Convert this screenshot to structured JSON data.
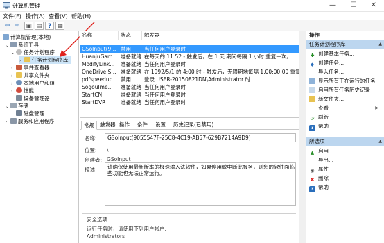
{
  "window": {
    "title": "计算机管理",
    "min_glyph": "—",
    "max_glyph": "☐",
    "close_glyph": "✕"
  },
  "menu": [
    "文件(F)",
    "操作(A)",
    "查看(V)",
    "帮助(H)"
  ],
  "toolbar": {
    "back_glyph": "⇦",
    "forward_glyph": "⇨",
    "up_glyph": "▣",
    "props_glyph": "▤",
    "help_glyph": "?",
    "view_glyph": "▦"
  },
  "tree": {
    "root": "计算机管理(本地)",
    "system_tools": "系统工具",
    "task_scheduler": "任务计划程序",
    "task_library": "任务计划程序库",
    "event_viewer": "事件查看器",
    "shared_folders": "共享文件夹",
    "local_users": "本地用户和组",
    "performance": "性能",
    "device_manager": "设备管理器",
    "storage": "存储",
    "disk_management": "磁盘管理",
    "services": "服务和应用程序"
  },
  "tasklist": {
    "columns": [
      "名称",
      "状态",
      "触发器"
    ],
    "rows": [
      {
        "name": "GSoInput(9...",
        "status": "禁用",
        "trigger": "当任何用户登录时"
      },
      {
        "name": "HuanjuGam...",
        "status": "准备就绪",
        "trigger": "在每天的 11:52 - 触发后，在 1 天 期间每隔 1 小时 重复一次。"
      },
      {
        "name": "ModifyLink...",
        "status": "准备就绪",
        "trigger": "当任何用户登录时"
      },
      {
        "name": "OneDrive S...",
        "status": "准备就绪",
        "trigger": "在 1992/5/1 的 4:00 时 - 触发后，无限期地每隔 1.00:00:00 重复一次。"
      },
      {
        "name": "pdfspeedup",
        "status": "禁用",
        "trigger": "登录 USER-20150821DN\\Administrator 时"
      },
      {
        "name": "SogouIme...",
        "status": "准备就绪",
        "trigger": "当任何用户登录时"
      },
      {
        "name": "StartCN",
        "status": "准备就绪",
        "trigger": "当任何用户登录时"
      },
      {
        "name": "StartDVR",
        "status": "准备就绪",
        "trigger": "当任何用户登录时"
      }
    ]
  },
  "details": {
    "tabs": [
      "常规",
      "触发器",
      "操作",
      "条件",
      "设置",
      "历史记录(已禁用)"
    ],
    "name_label": "名称:",
    "name_value": "GSoInput(9055547F-25C8-4C19-AB57-629B7214A9D9)",
    "location_label": "位置:",
    "location_value": "\\",
    "author_label": "创建者:",
    "author_value": "GSoInput",
    "desc_label": "描述:",
    "desc_line1": "请确保使用最新版本的极速输入法软件，如果停用或中断此服务，则您的软件面临安全风险，",
    "desc_line2": "些功能也无法正常运行。",
    "security_title": "安全选项",
    "run_as_label": "运行任务时，请使用下列用户帐户:",
    "run_as_value": "Administrators"
  },
  "actions": {
    "header": "操作",
    "section1": "任务计划程序库",
    "items1": [
      "创建基本任务...",
      "创建任务...",
      "导入任务...",
      "显示所有正在运行的任务",
      "启用所有任务历史记录",
      "新文件夹...",
      "查看",
      "刷新",
      "帮助"
    ],
    "section2": "所选项",
    "items2": [
      "启用",
      "导出...",
      "属性",
      "删除",
      "帮助"
    ]
  }
}
